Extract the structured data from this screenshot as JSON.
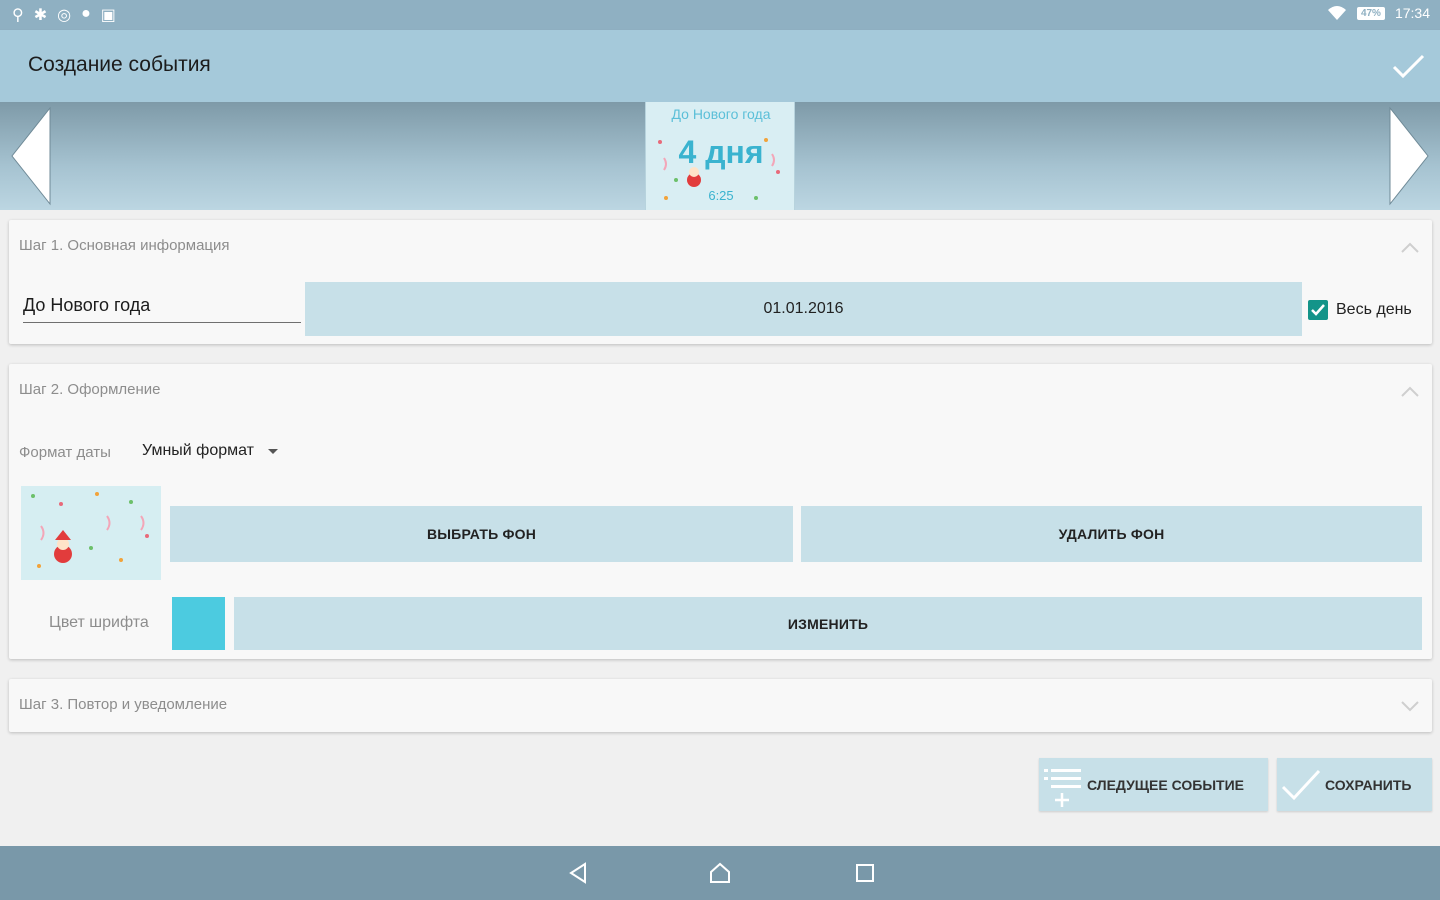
{
  "status_bar": {
    "left_icons": [
      "usb-icon",
      "bluetooth-icon",
      "data-saver-icon",
      "location-icon",
      "gallery-icon"
    ],
    "battery": "47%",
    "time": "17:34"
  },
  "app_bar": {
    "title": "Создание события",
    "confirm_icon": "check-icon"
  },
  "banner": {
    "preview": {
      "title": "До Нового года",
      "days": "4 дня",
      "time": "6:25"
    }
  },
  "step1": {
    "label": "Шаг 1. Основная информация",
    "name_value": "До Нового года",
    "date_value": "01.01.2016",
    "all_day_label": "Весь день",
    "all_day_checked": true
  },
  "step2": {
    "label": "Шаг 2. Оформление",
    "date_format_label": "Формат даты",
    "date_format_value": "Умный формат",
    "choose_bg_label": "ВЫБРАТЬ ФОН",
    "delete_bg_label": "УДАЛИТЬ ФОН",
    "font_color_label": "Цвет шрифта",
    "font_color": "#4ccbe0",
    "change_label": "ИЗМЕНИТЬ"
  },
  "step3": {
    "label": "Шаг 3. Повтор и уведомление"
  },
  "actions": {
    "next_event_label": "СЛЕДУЩЕЕ СОБЫТИЕ",
    "save_label": "СОХРАНИТЬ"
  },
  "colors": {
    "app_bar": "#a5c9da",
    "button_bg": "#c7e0e8",
    "accent_checkbox": "#139489",
    "nav_bar": "#7998a9"
  }
}
